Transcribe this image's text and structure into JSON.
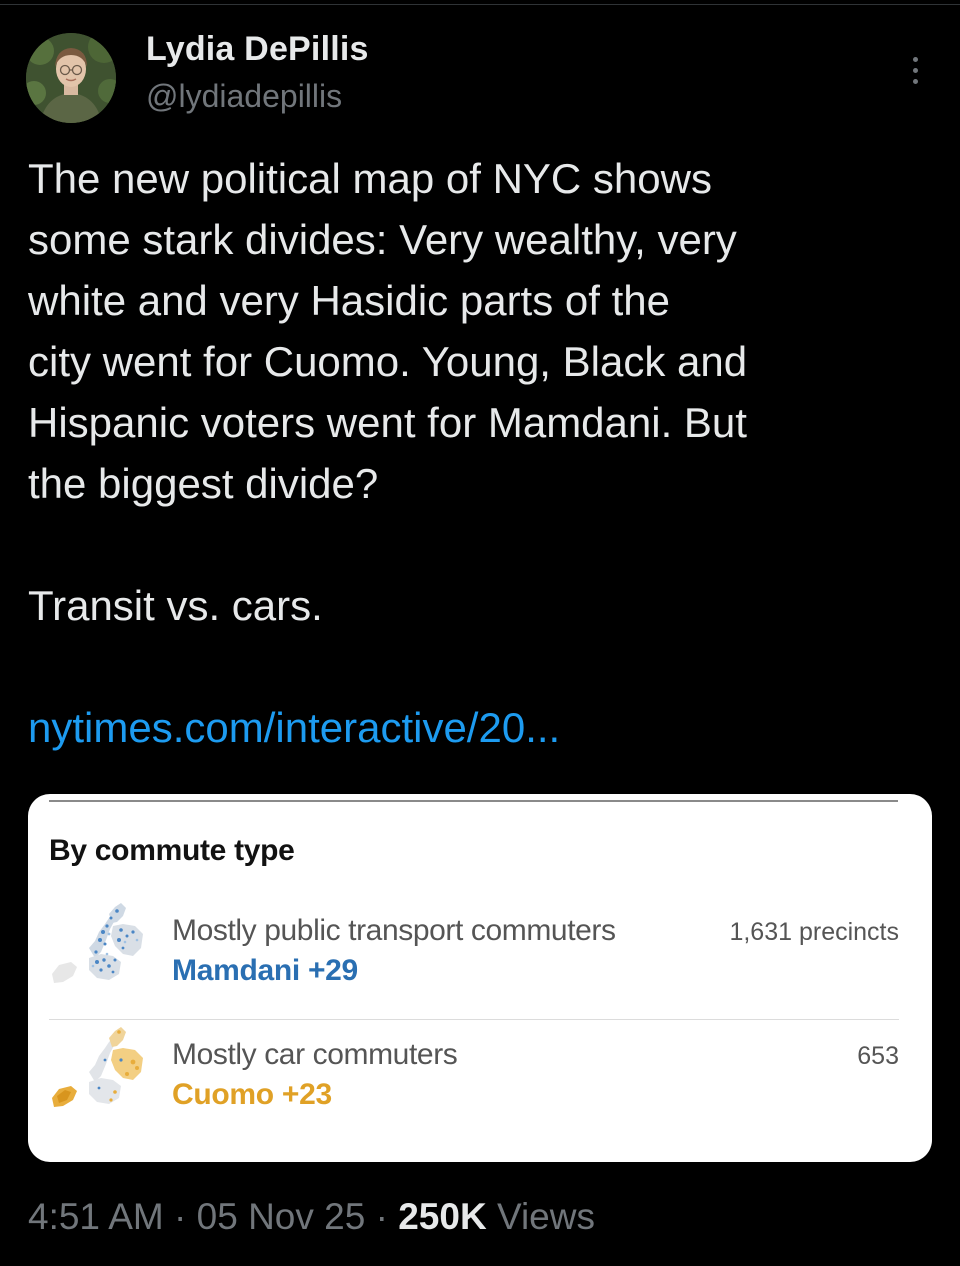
{
  "author": {
    "display_name": "Lydia DePillis",
    "handle": "@lydiadepillis"
  },
  "tweet": {
    "lines": [
      "The new political map of NYC shows",
      "some stark divides: Very wealthy, very",
      "white and very Hasidic parts of the",
      "city went for Cuomo. Young, Black and",
      "Hispanic voters went for Mamdani. But",
      "the biggest divide?"
    ],
    "paragraph2": "Transit vs. cars.",
    "link_text": "nytimes.com/interactive/20..."
  },
  "card": {
    "title": "By commute type",
    "rows": [
      {
        "label": "Mostly public transport commuters",
        "result": "Mamdani +29",
        "result_color": "#2a6fb2",
        "count": "1,631 precincts"
      },
      {
        "label": "Mostly car commuters",
        "result": "Cuomo +23",
        "result_color": "#e0a126",
        "count": "653"
      }
    ]
  },
  "footer": {
    "time": "4:51 AM",
    "sep1": "·",
    "date": "05 Nov 25",
    "sep2": "·",
    "views_count": "250K",
    "views_label": "Views"
  },
  "icons": {
    "more": "more-dots-icon",
    "map_transit": "nyc-map-transit-icon",
    "map_car": "nyc-map-car-icon"
  },
  "colors": {
    "background": "#000000",
    "text_primary": "#e7e9ea",
    "text_secondary": "#71767b",
    "link": "#1d9bf0",
    "mamdani": "#2a6fb2",
    "cuomo": "#e0a126"
  }
}
